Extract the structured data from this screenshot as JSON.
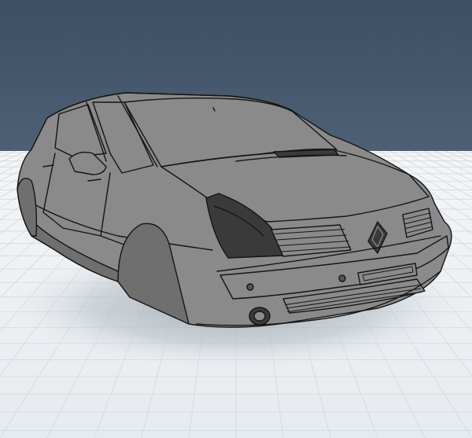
{
  "viewport": {
    "sky_color_top": "#3d4f63",
    "sky_color_bottom": "#4d6076",
    "floor_color": "#e6ebef",
    "grid_color": "#cdd5dc"
  },
  "model": {
    "name": "car-wireframe-model",
    "body_color": "#8a8a8a",
    "shade_color": "#6f6f6f",
    "dark_color": "#3a3a3a",
    "outline_color": "#151515",
    "logo": "renault-diamond-logo"
  }
}
